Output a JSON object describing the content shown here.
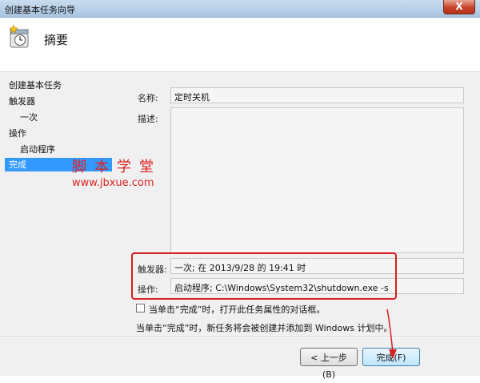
{
  "window": {
    "title": "创建基本任务向导",
    "close_glyph": "X"
  },
  "header": {
    "title": "摘要",
    "icon": "task-scheduler-icon"
  },
  "nav": {
    "items": [
      {
        "label": "创建基本任务"
      },
      {
        "label": "触发器"
      },
      {
        "label": "一次"
      },
      {
        "label": "操作"
      },
      {
        "label": "启动程序"
      },
      {
        "label": "完成"
      }
    ],
    "active_index": 5
  },
  "watermark": {
    "cn": "脚本学堂",
    "url": "www.jbxue.com",
    "color": "#d22222"
  },
  "form": {
    "name_label": "名称:",
    "name_value": "定时关机",
    "desc_label": "描述:",
    "desc_value": "",
    "trigger_label": "触发器:",
    "trigger_value": "一次; 在 2013/9/28 的 19:41 时",
    "action_label": "操作:",
    "action_value": "启动程序; C:\\Windows\\System32\\shutdown.exe -s"
  },
  "checkbox": {
    "label": "当单击“完成”时，打开此任务属性的对话框。",
    "checked": false
  },
  "note": "当单击“完成”时，新任务将会被创建并添加到 Windows 计划中。",
  "buttons": {
    "back": "< 上一步(B)",
    "finish": "完成(F)"
  },
  "colors": {
    "highlight": "#3399ff",
    "annotation_red": "#d81e1e"
  }
}
